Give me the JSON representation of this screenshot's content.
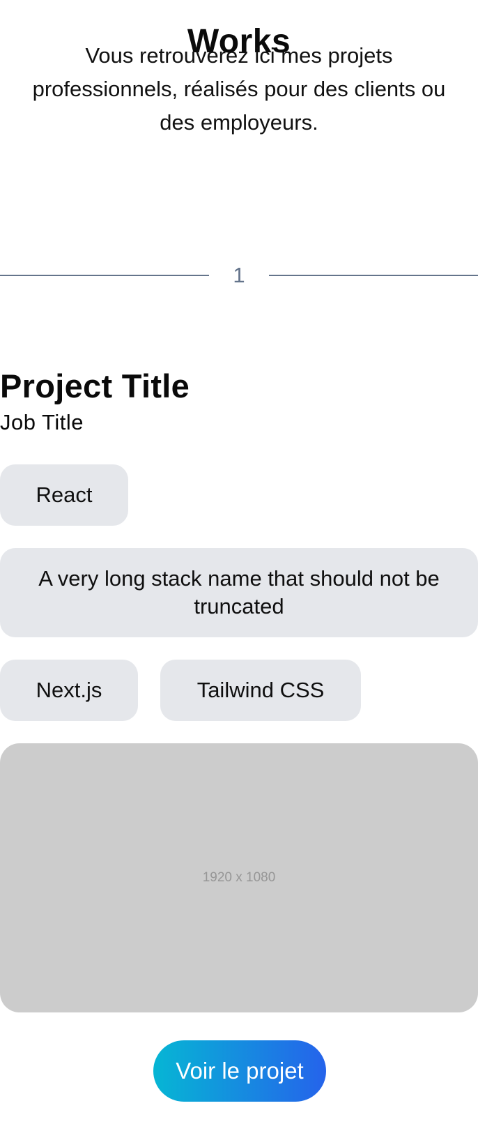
{
  "header": {
    "title": "Works",
    "intro": "Vous retrouverez ici mes projets professionnels, réalisés pour des clients ou des employeurs."
  },
  "divider": {
    "number": "1"
  },
  "project": {
    "title": "Project Title",
    "job_title": "Job Title",
    "stacks": [
      "React",
      "A very long stack name that should not be truncated",
      "Next.js",
      "Tailwind CSS"
    ],
    "image_placeholder": "1920 x 1080",
    "cta_label": "Voir le projet"
  },
  "colors": {
    "chip_bg": "#e5e7eb",
    "divider": "#64748b",
    "cta_gradient_start": "#06b6d4",
    "cta_gradient_end": "#2563eb",
    "image_bg": "#cccccc"
  }
}
